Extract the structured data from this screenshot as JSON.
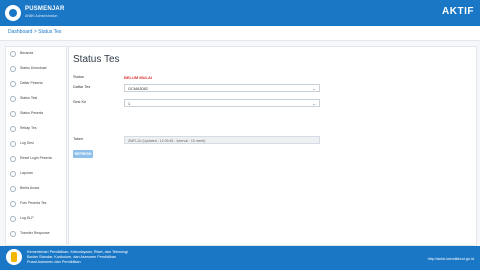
{
  "header": {
    "brand": "PUSMENJAR",
    "brand_sub": "ANBK Administration",
    "status": "AKTIF"
  },
  "breadcrumb": "Dashboard > Status Tes",
  "sidebar": {
    "items": [
      {
        "label": "Beranda"
      },
      {
        "label": "Status Download"
      },
      {
        "label": "Daftar Peserta"
      },
      {
        "label": "Status Test"
      },
      {
        "label": "Status Peserta"
      },
      {
        "label": "Rekap Tes"
      },
      {
        "label": "Log Sesi"
      },
      {
        "label": "Reset Login Peserta"
      },
      {
        "label": "Laporan"
      },
      {
        "label": "Berita Acara"
      },
      {
        "label": "Foto Peserta Tes"
      },
      {
        "label": "Log DLP"
      },
      {
        "label": "Transfer Response"
      }
    ]
  },
  "main": {
    "title": "Status Tes",
    "status_label": "Status",
    "status_value": "BELUM MULAI",
    "test_label": "Daftar Tes",
    "test_value": "GCMA3082",
    "session_label": "Sesi Ke",
    "session_value": "1",
    "token_label": "Token",
    "token_value": "ZMFLJU (Updated : 12:09:45 - Interval : 15 menit)",
    "refresh_label": "REFRESH"
  },
  "footer": {
    "line1": "Kementerian Pendidikan, Kebudayaan, Riset, dan Teknologi",
    "line2": "Badan Standar, Kurikulum, dan Asesmen Pendidikan",
    "line3": "Pusat Asesmen dan Pendidikan",
    "url": "http://anbk.kemdikbud.go.id"
  }
}
